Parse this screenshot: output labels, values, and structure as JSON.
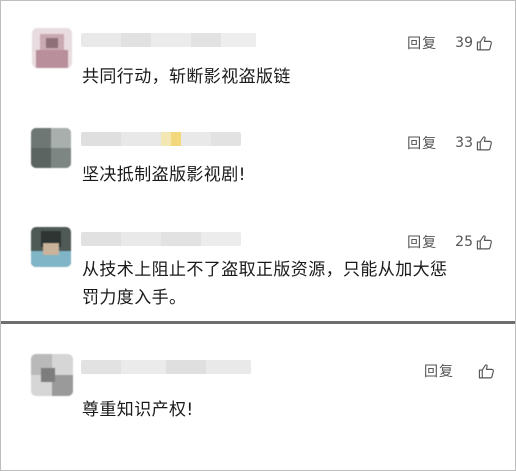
{
  "comments": [
    {
      "reply_label": "回复",
      "likes": "39",
      "text": "共同行动，斩断影视盗版链",
      "username_hidden": true
    },
    {
      "reply_label": "回复",
      "likes": "33",
      "text": "坚决抵制盗版影视剧!",
      "username_hidden": true
    },
    {
      "reply_label": "回复",
      "likes": "25",
      "text": "从技术上阻止不了盗取正版资源，只能从加大惩罚力度入手。",
      "text_line1": "从技术上阻止不了盗取正版资源，只能从加大惩",
      "text_line2": "罚力度入手。",
      "username_hidden": true
    },
    {
      "reply_label": "回复",
      "likes": "",
      "text": "尊重知识产权!",
      "username_hidden": true
    }
  ],
  "icons": {
    "like": "thumbs-up-icon"
  },
  "colors": {
    "meta_text": "#555555",
    "divider": "#6e6e6e",
    "body_text": "#1a1a1a"
  }
}
